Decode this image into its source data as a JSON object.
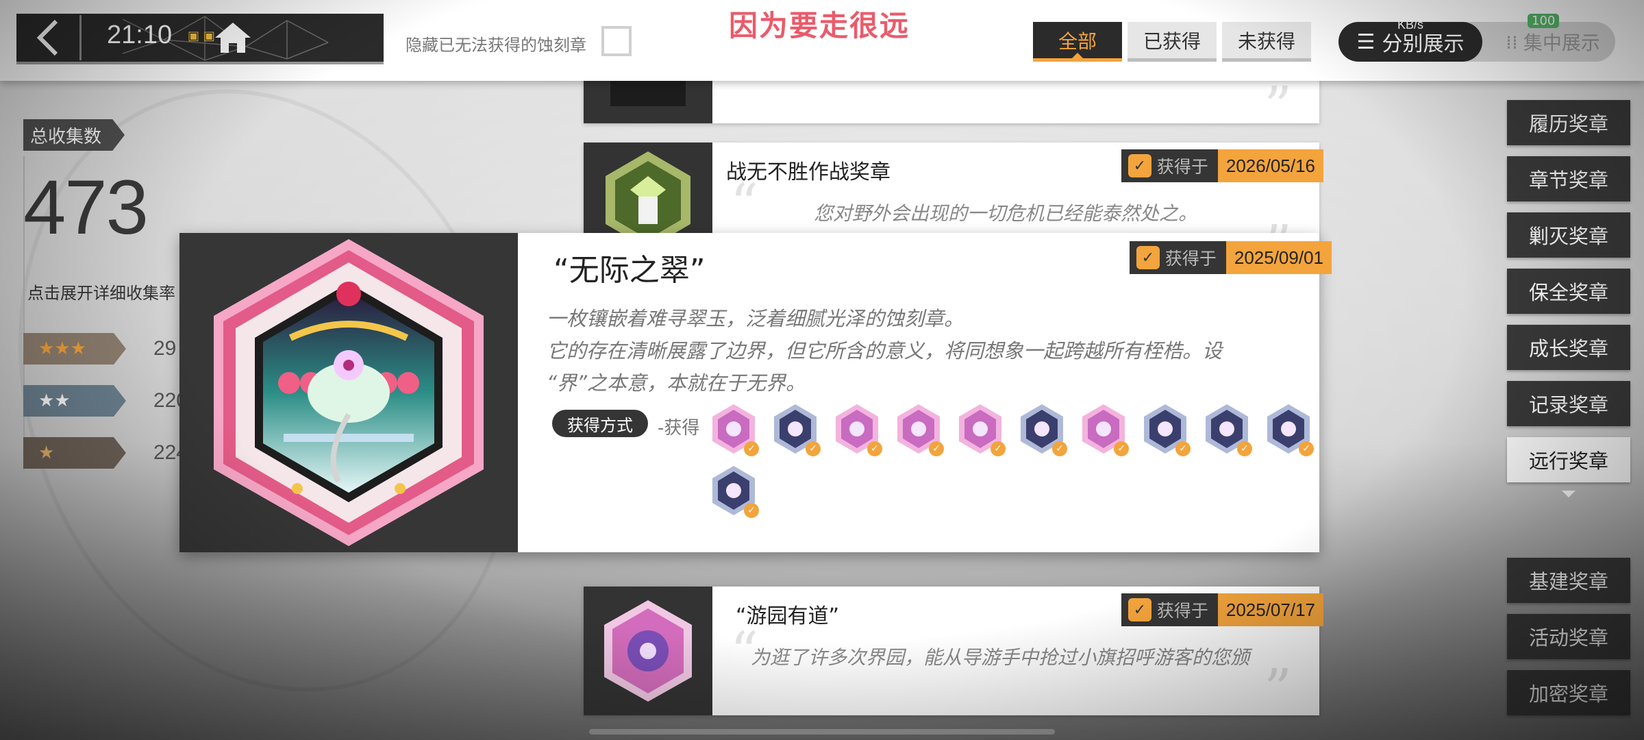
{
  "status": {
    "time": "21:10",
    "kbs": "KB/s",
    "battery": "100"
  },
  "topbar": {
    "hide_label": "隐藏已无法获得的蚀刻章",
    "overlay_text": "因为要走很远",
    "filters": [
      "全部",
      "已获得",
      "未获得"
    ],
    "view_separate": "分别展示",
    "view_combined": "集中展示"
  },
  "stats": {
    "total_label": "总收集数",
    "total": "473",
    "expand_label": "点击展开详细收集率",
    "rows": [
      {
        "stars": "★★★",
        "count": "29",
        "color": "#7a6a5a"
      },
      {
        "stars": "★★",
        "count": "220",
        "color": "#5c7180"
      },
      {
        "stars": "★",
        "count": "224",
        "color": "#5e5650"
      }
    ]
  },
  "cards": [
    {
      "title": "战无不胜作战奖章",
      "quote": "您对野外会出现的一切危机已经能泰然处之。",
      "gain_label": "获得于",
      "date": "2026/05/16"
    },
    {
      "title": "“游园有道”",
      "quote": "为逛了许多次界园，能从导游手中抢过小旗招呼游客的您颁",
      "gain_label": "获得于",
      "date": "2025/07/17"
    }
  ],
  "detail": {
    "title": "“无际之翠”",
    "gain_label": "获得于",
    "date": "2025/09/01",
    "desc": [
      "一枚镶嵌着难寻翠玉，泛着细腻光泽的蚀刻章。",
      "它的存在清晰展露了边界，但它所含的意义，将同想象一起跨越所有桎梏。设",
      "“界”之本意，本就在于无界。"
    ],
    "method_label": "获得方式",
    "method_text": "-获得",
    "badges": [
      "pink",
      "blue",
      "pink",
      "pink",
      "pink",
      "blue",
      "pink",
      "blue",
      "blue",
      "blue",
      "blue"
    ]
  },
  "sidebar": {
    "items": [
      "履历奖章",
      "章节奖章",
      "剿灭奖章",
      "保全奖章",
      "成长奖章",
      "记录奖章",
      "远行奖章",
      "基建奖章",
      "活动奖章",
      "加密奖章"
    ],
    "active": "远行奖章"
  },
  "colors": {
    "accent": "#f3a43c",
    "dark": "#2b2b2b"
  }
}
